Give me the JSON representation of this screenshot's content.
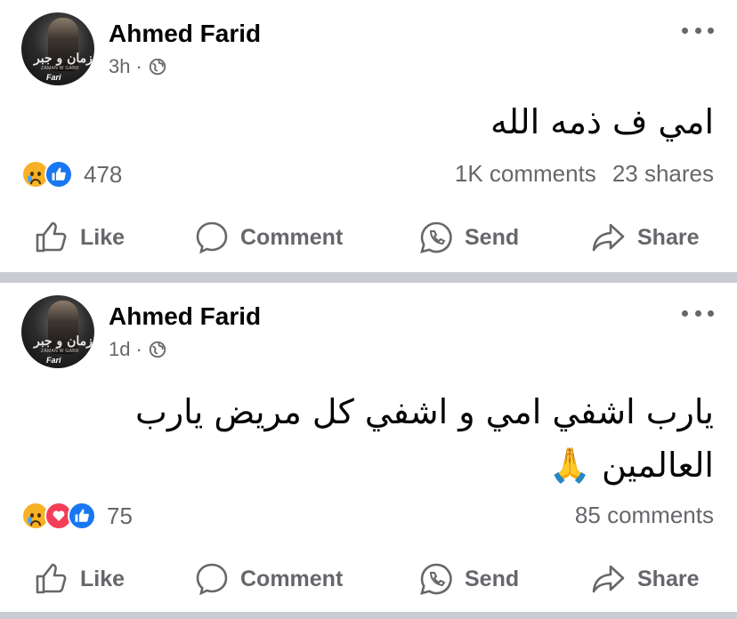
{
  "posts": [
    {
      "author": "Ahmed Farid",
      "time": "3h",
      "text": "امي ف ذمه الله",
      "reaction_count": "478",
      "reactions": [
        "sad-reaction-icon",
        "like-reaction-icon"
      ],
      "comments": "1K comments",
      "shares": "23 shares"
    },
    {
      "author": "Ahmed Farid",
      "time": "1d",
      "text_line1": "يارب اشفي امي و اشفي كل مريض يارب",
      "text_line2": "العالمين 🙏",
      "reaction_count": "75",
      "reactions": [
        "sad-reaction-icon",
        "love-reaction-icon",
        "like-reaction-icon"
      ],
      "comments": "85 comments"
    }
  ],
  "actions": {
    "like": "Like",
    "comment": "Comment",
    "send": "Send",
    "share": "Share"
  },
  "avatar": {
    "logo_text": "زمان و جبر",
    "logo_sub": "ZAMAN W GABR",
    "brand": "Fari"
  },
  "colors": {
    "like": "#1877f2",
    "love": "#f33e58",
    "sad": "#f7b125",
    "muted": "#65676b",
    "divider": "#c9ccd1"
  }
}
